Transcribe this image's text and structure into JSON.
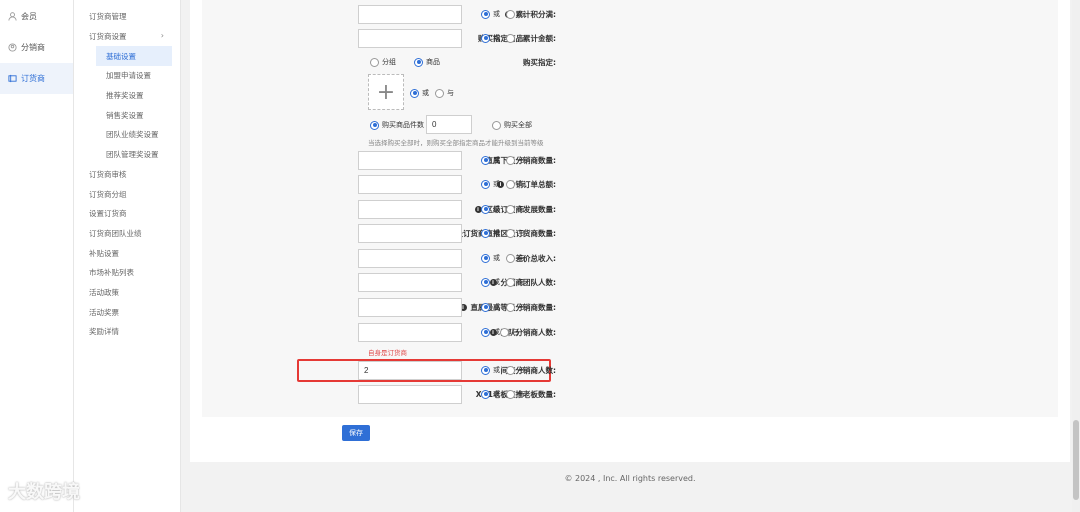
{
  "sidebar1": {
    "items": [
      "会员",
      "分销商",
      "订货商"
    ]
  },
  "sidebar2": {
    "items": [
      "订货商管理",
      "订货商设置",
      "基础设置",
      "加盟申请设置",
      "推荐奖设置",
      "销售奖设置",
      "团队业绩奖设置",
      "团队管理奖设置",
      "订货商审核",
      "订货商分组",
      "设置订货商",
      "订货商团队业绩",
      "补贴设置",
      "市场补贴列表",
      "活动政策",
      "活动奖票",
      "奖励详情"
    ]
  },
  "radio": {
    "or": "或",
    "and": "与"
  },
  "form": {
    "r1_label": "累计积分满:",
    "r2_label": "购买指定商品累计金额:",
    "buy_label": "购买指定:",
    "buy_group": "分组",
    "buy_product": "商品",
    "buy_count": "购买商品件数",
    "buy_count_value": "0",
    "buy_all": "购买全部",
    "hint": "当选择购买全部时，则购买全部指定商品才能升级到当前等级",
    "r3_label": "直属下级分销商数量:",
    "r4_label": "分销订单总额:",
    "r5_label": "区级订货商发展数量:",
    "r6_label": "区级订货商直推区级订货商数量:",
    "r7_label": "差价总收入:",
    "r8_label": "分销商团队人数:",
    "r9_label": "直属最高等级分销商数量:",
    "r10_label": "团队分销商人数:",
    "warn": "自身是订货商",
    "r11_label": "间接分销商人数:",
    "r11_value": "2",
    "r12_label": "X+1老板直推老板数量:",
    "save": "保存"
  },
  "footer": "© 2024 , Inc. All rights reserved.",
  "watermark": "大数跨境",
  "colors": {
    "accent": "#2f6fd6",
    "highlight": "#e53935"
  }
}
